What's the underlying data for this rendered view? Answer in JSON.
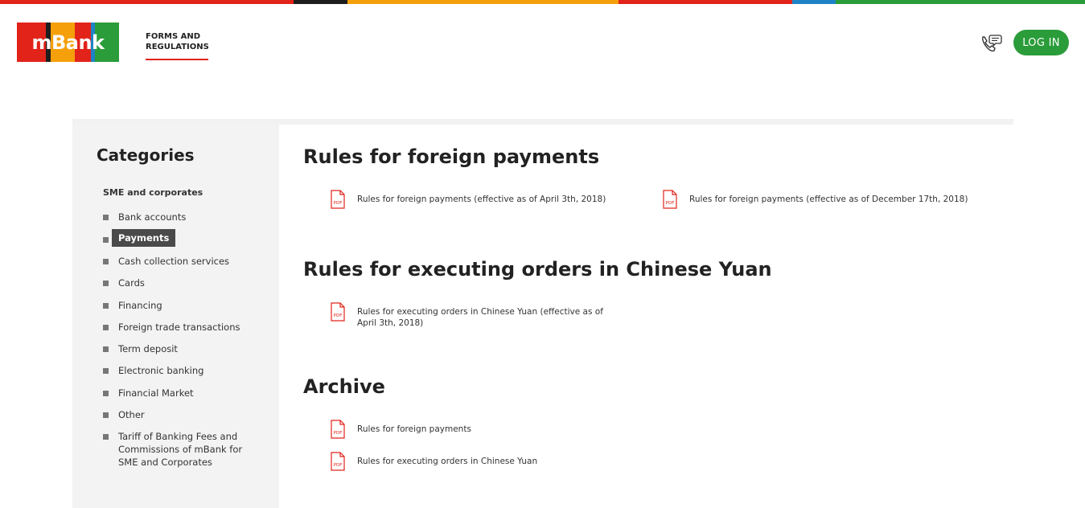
{
  "brand": {
    "logo_text": "mBank",
    "colors": {
      "red": "#e2231a",
      "black": "#1e1e1e",
      "orange": "#f5a00a",
      "blue": "#1e83c6",
      "green": "#2b9c3a"
    }
  },
  "header": {
    "nav_link": "FORMS AND REGULATIONS",
    "phone_icon": "phone-chat-icon",
    "login_label": "LOG IN"
  },
  "sidebar": {
    "title": "Categories",
    "group": "SME and corporates",
    "items": [
      {
        "label": "Bank accounts",
        "active": false
      },
      {
        "label": "Payments",
        "active": true
      },
      {
        "label": "Cash collection services",
        "active": false
      },
      {
        "label": "Cards",
        "active": false
      },
      {
        "label": "Financing",
        "active": false
      },
      {
        "label": "Foreign trade transactions",
        "active": false
      },
      {
        "label": "Term deposit",
        "active": false
      },
      {
        "label": "Electronic banking",
        "active": false
      },
      {
        "label": "Financial Market",
        "active": false
      },
      {
        "label": "Other",
        "active": false
      },
      {
        "label": "Tariff of Banking Fees and Commissions of mBank for SME and Corporates",
        "active": false
      }
    ]
  },
  "sections": [
    {
      "title": "Rules for foreign payments",
      "documents": [
        {
          "label": "Rules for foreign payments (effective as of April 3th, 2018)",
          "icon": "pdf-icon"
        },
        {
          "label": "Rules for foreign payments (effective as of December 17th, 2018)",
          "icon": "pdf-icon"
        }
      ]
    },
    {
      "title": "Rules for executing orders in Chinese Yuan",
      "documents": [
        {
          "label": "Rules for executing orders in Chinese Yuan (effective as of  April 3th, 2018)",
          "icon": "pdf-icon"
        }
      ]
    },
    {
      "title": "Archive",
      "documents": [
        {
          "label": "Rules for foreign payments",
          "icon": "pdf-icon"
        },
        {
          "label": "Rules for executing orders in Chinese Yuan",
          "icon": "pdf-icon"
        }
      ]
    }
  ],
  "pdf_badge": "PDF"
}
